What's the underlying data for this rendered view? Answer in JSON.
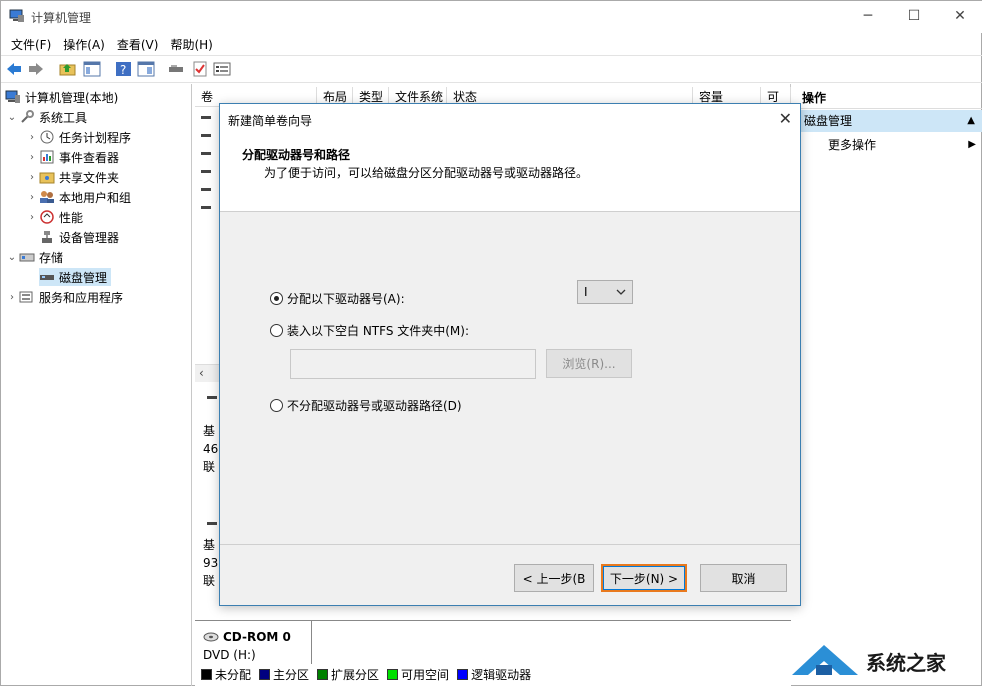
{
  "window": {
    "title": "计算机管理"
  },
  "window_controls": {
    "minimize": "─",
    "maximize": "☐",
    "close": "✕"
  },
  "menu": [
    "文件(F)",
    "操作(A)",
    "查看(V)",
    "帮助(H)"
  ],
  "tree": {
    "root": "计算机管理(本地)",
    "system_tools": "系统工具",
    "task_scheduler": "任务计划程序",
    "event_viewer": "事件查看器",
    "shared_folders": "共享文件夹",
    "local_users": "本地用户和组",
    "performance": "性能",
    "device_manager": "设备管理器",
    "storage": "存储",
    "disk_management": "磁盘管理",
    "services_apps": "服务和应用程序"
  },
  "columns": [
    "卷",
    "布局",
    "类型",
    "文件系统",
    "状态",
    "容量",
    "可"
  ],
  "disk_panel": {
    "disk0_a": "基",
    "disk0_b": "46",
    "disk0_c": "联",
    "disk1_a": "基",
    "disk1_b": "93",
    "disk1_c": "联",
    "cdrom_title": "CD-ROM 0",
    "cdrom_sub": "DVD (H:)"
  },
  "legend": [
    {
      "label": "未分配",
      "color": "#000000"
    },
    {
      "label": "主分区",
      "color": "#000080"
    },
    {
      "label": "扩展分区",
      "color": "#008000"
    },
    {
      "label": "可用空间",
      "color": "#00e000"
    },
    {
      "label": "逻辑驱动器",
      "color": "#0000ff"
    }
  ],
  "actions": {
    "header": "操作",
    "section": "磁盘管理",
    "more": "更多操作"
  },
  "dialog": {
    "title": "新建简单卷向导",
    "heading": "分配驱动器号和路径",
    "subheading": "为了便于访问，可以给磁盘分区分配驱动器号或驱动器路径。",
    "option_assign": "分配以下驱动器号(A):",
    "option_mount": "装入以下空白 NTFS 文件夹中(M):",
    "option_none": "不分配驱动器号或驱动器路径(D)",
    "drive_letter": "I",
    "browse": "浏览(R)...",
    "back": "< 上一步(B",
    "next": "下一步(N) >",
    "cancel": "取消"
  },
  "watermark": {
    "text": "系统之家"
  }
}
